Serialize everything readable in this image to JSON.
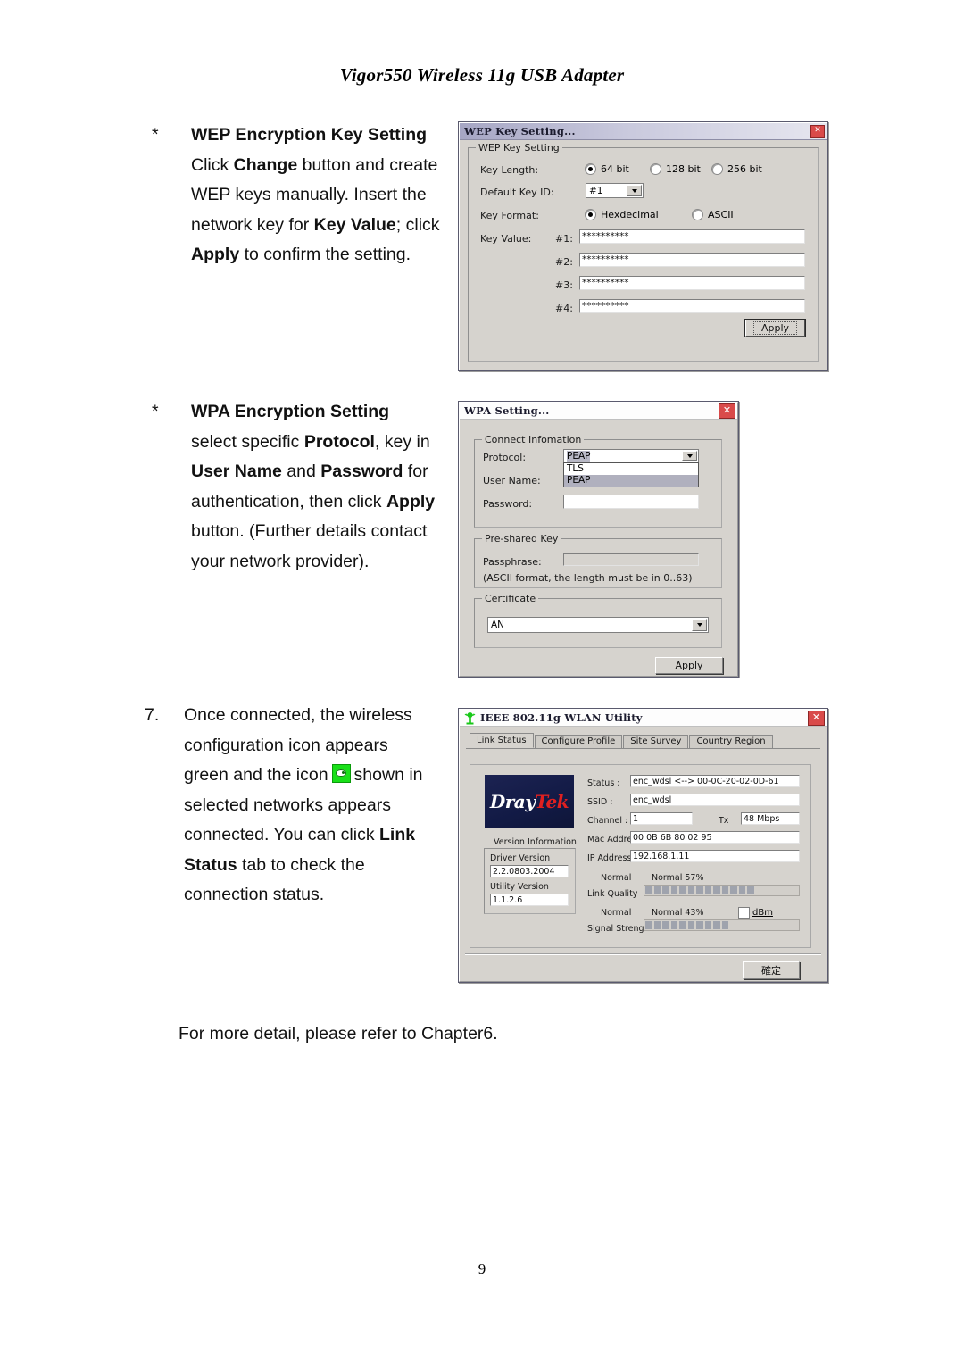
{
  "page": {
    "header_title": "Vigor550 Wireless 11g USB Adapter",
    "page_number": "9",
    "footer_note": "For more detail, please refer to Chapter6."
  },
  "sections": {
    "wep": {
      "marker": "*",
      "heading": "WEP Encryption Key Setting",
      "line1_a": "Click ",
      "line1_b": "Change",
      "line1_c": " button and create",
      "line2": "WEP keys manually. Insert the",
      "line3_a": "network key for ",
      "line3_b": "Key Value",
      "line3_c": "; click",
      "line4_a": "Apply",
      "line4_b": " to confirm the setting."
    },
    "wpa": {
      "marker": "*",
      "heading": "WPA Encryption Setting",
      "line1_a": "select specific ",
      "line1_b": "Protocol",
      "line1_c": ", key in",
      "line2_a": "User Name",
      "line2_b": " and ",
      "line2_c": "Password",
      "line2_d": " for",
      "line3_a": "authentication, then click ",
      "line3_b": "Apply",
      "line4": "button. (Further details contact",
      "line5": "your network provider)."
    },
    "step7": {
      "marker": "7.",
      "line1": "Once connected, the wireless",
      "line2": "configuration icon appears",
      "line3_a": "green and the icon",
      "line3_icon": "wireless-connected-icon",
      "line3_b": "shown in",
      "line4": "selected networks appears",
      "line5_a": "connected. You can click ",
      "line5_b": "Link",
      "line6_a": "Status",
      "line6_b": " tab to check the",
      "line7": "connection status."
    }
  },
  "wep_dialog": {
    "title": "WEP Key Setting...",
    "close_label": "✕",
    "group_legend": "WEP Key Setting",
    "key_length_label": "Key Length:",
    "key_length_options": [
      "64 bit",
      "128 bit",
      "256 bit"
    ],
    "key_length_selected": "64 bit",
    "default_key_id_label": "Default Key ID:",
    "default_key_id_value": "#1",
    "key_format_label": "Key Format:",
    "key_format_options": [
      "Hexdecimal",
      "ASCII"
    ],
    "key_format_selected": "Hexdecimal",
    "key_value_label": "Key Value:",
    "keys": [
      {
        "id": "#1:",
        "value": "**********"
      },
      {
        "id": "#2:",
        "value": "**********"
      },
      {
        "id": "#3:",
        "value": "**********"
      },
      {
        "id": "#4:",
        "value": "**********"
      }
    ],
    "apply_label": "Apply"
  },
  "wpa_dialog": {
    "title": "WPA Setting...",
    "close_label": "✕",
    "connect_info_legend": "Connect Infomation",
    "protocol_label": "Protocol:",
    "protocol_value": "PEAP",
    "protocol_options": [
      "TLS",
      "PEAP"
    ],
    "protocol_selected": "PEAP",
    "user_name_label": "User Name:",
    "user_name_value": "",
    "password_label": "Password:",
    "password_value": "",
    "psk_legend": "Pre-shared Key",
    "passphrase_label": "Passphrase:",
    "passphrase_value": "",
    "passphrase_hint": "(ASCII format, the length must be in 0..63)",
    "certificate_legend": "Certificate",
    "certificate_value": "AN",
    "apply_label": "Apply"
  },
  "wlan_dialog": {
    "title": "IEEE 802.11g WLAN Utility",
    "close_label": "✕",
    "app_icon": "wlan-utility-icon",
    "tabs": [
      {
        "label": "Link Status",
        "active": true
      },
      {
        "label": "Configure Profile",
        "active": false
      },
      {
        "label": "Site Survey",
        "active": false
      },
      {
        "label": "Country Region",
        "active": false
      }
    ],
    "logo_part1": "Dray",
    "logo_part2": "Tek",
    "version_info_label": "Version Information",
    "driver_version_label": "Driver Version",
    "driver_version_value": "2.2.0803.2004",
    "utility_version_label": "Utility Version",
    "utility_version_value": "1.1.2.6",
    "status_label": "Status :",
    "status_value": "enc_wdsl <--> 00-0C-20-02-0D-61",
    "ssid_label": "SSID :",
    "ssid_value": "enc_wdsl",
    "channel_label": "Channel :",
    "channel_value": "1",
    "tx_label": "Tx",
    "tx_value": "48 Mbps",
    "mac_label": "Mac Address",
    "mac_value": "00 0B 6B 80 02 95",
    "ip_label": "IP Address :",
    "ip_value": "192.168.1.11",
    "link_quality_label": "Link Quality",
    "link_quality_state": "Normal",
    "link_quality_value": "Normal 57%",
    "link_quality_percent": 57,
    "signal_strength_label": "Signal Strength",
    "signal_strength_state": "Normal",
    "signal_strength_value": "Normal 43%",
    "signal_strength_percent": 43,
    "dbm_label": "dBm",
    "ok_label": "確定"
  },
  "colors": {
    "titlebar_blue": "#a6a6c4",
    "close_red": "#d94a4a",
    "dialog_face": "#d6d3ce",
    "logo_red": "#e02020",
    "icon_green": "#19e019"
  }
}
